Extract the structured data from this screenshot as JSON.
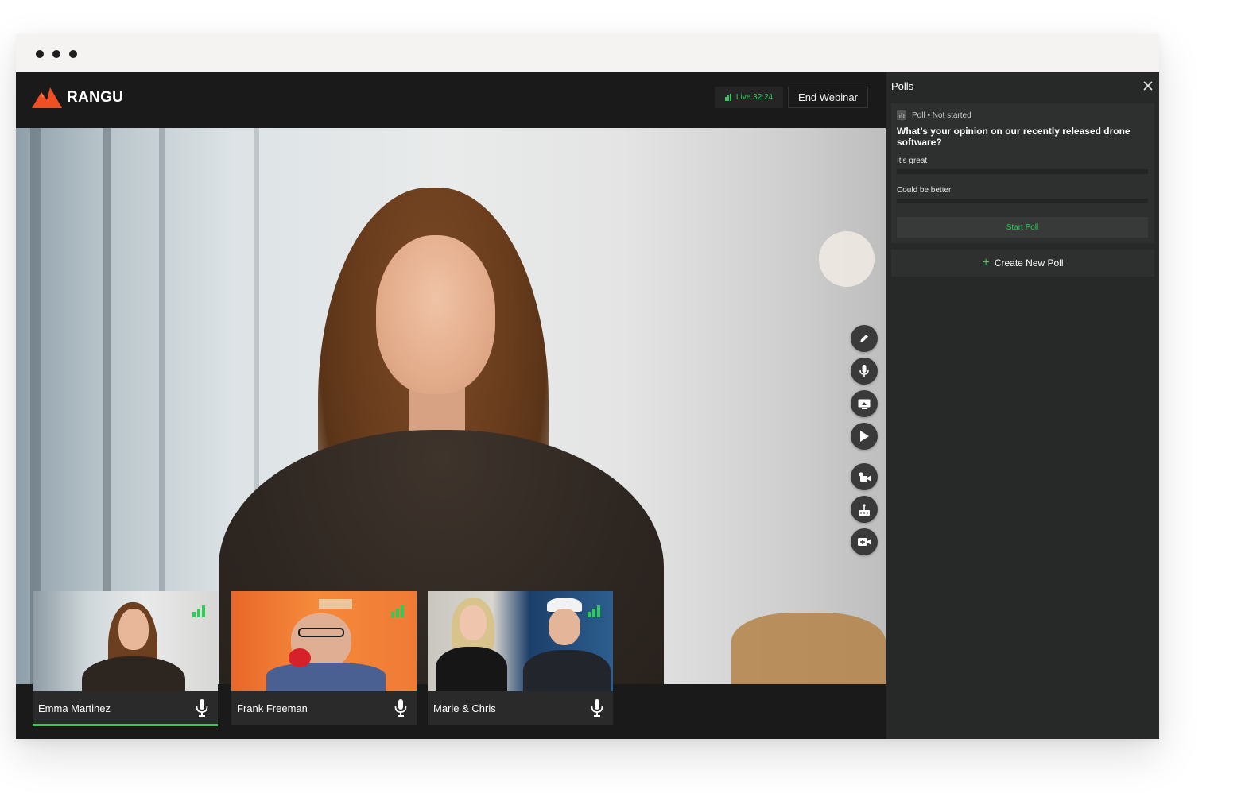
{
  "app": {
    "name": "RANGU"
  },
  "header": {
    "live_label": "Live 32:24",
    "end_button_label": "End Webinar"
  },
  "toolbar": {
    "tools": [
      "pencil-icon",
      "microphone-icon",
      "share-screen-icon",
      "play-icon",
      "camera-settings-icon",
      "broadcast-icon",
      "add-video-icon"
    ]
  },
  "participants": [
    {
      "name": "Emma Martinez",
      "speaking": true
    },
    {
      "name": "Frank Freeman",
      "speaking": false
    },
    {
      "name": "Marie & Chris",
      "speaking": false
    }
  ],
  "polls": {
    "title": "Polls",
    "card": {
      "status": "Poll • Not started",
      "question": "What’s your opinion on our recently released drone software?",
      "options": [
        {
          "label": "It’s great"
        },
        {
          "label": "Could be better"
        }
      ],
      "start_label": "Start Poll"
    },
    "create_label": "Create New Poll"
  },
  "colors": {
    "accent_green": "#2fca57",
    "brand_red": "#f04e23",
    "panel_bg": "#272828",
    "stage_bg": "#1a1a1a"
  }
}
